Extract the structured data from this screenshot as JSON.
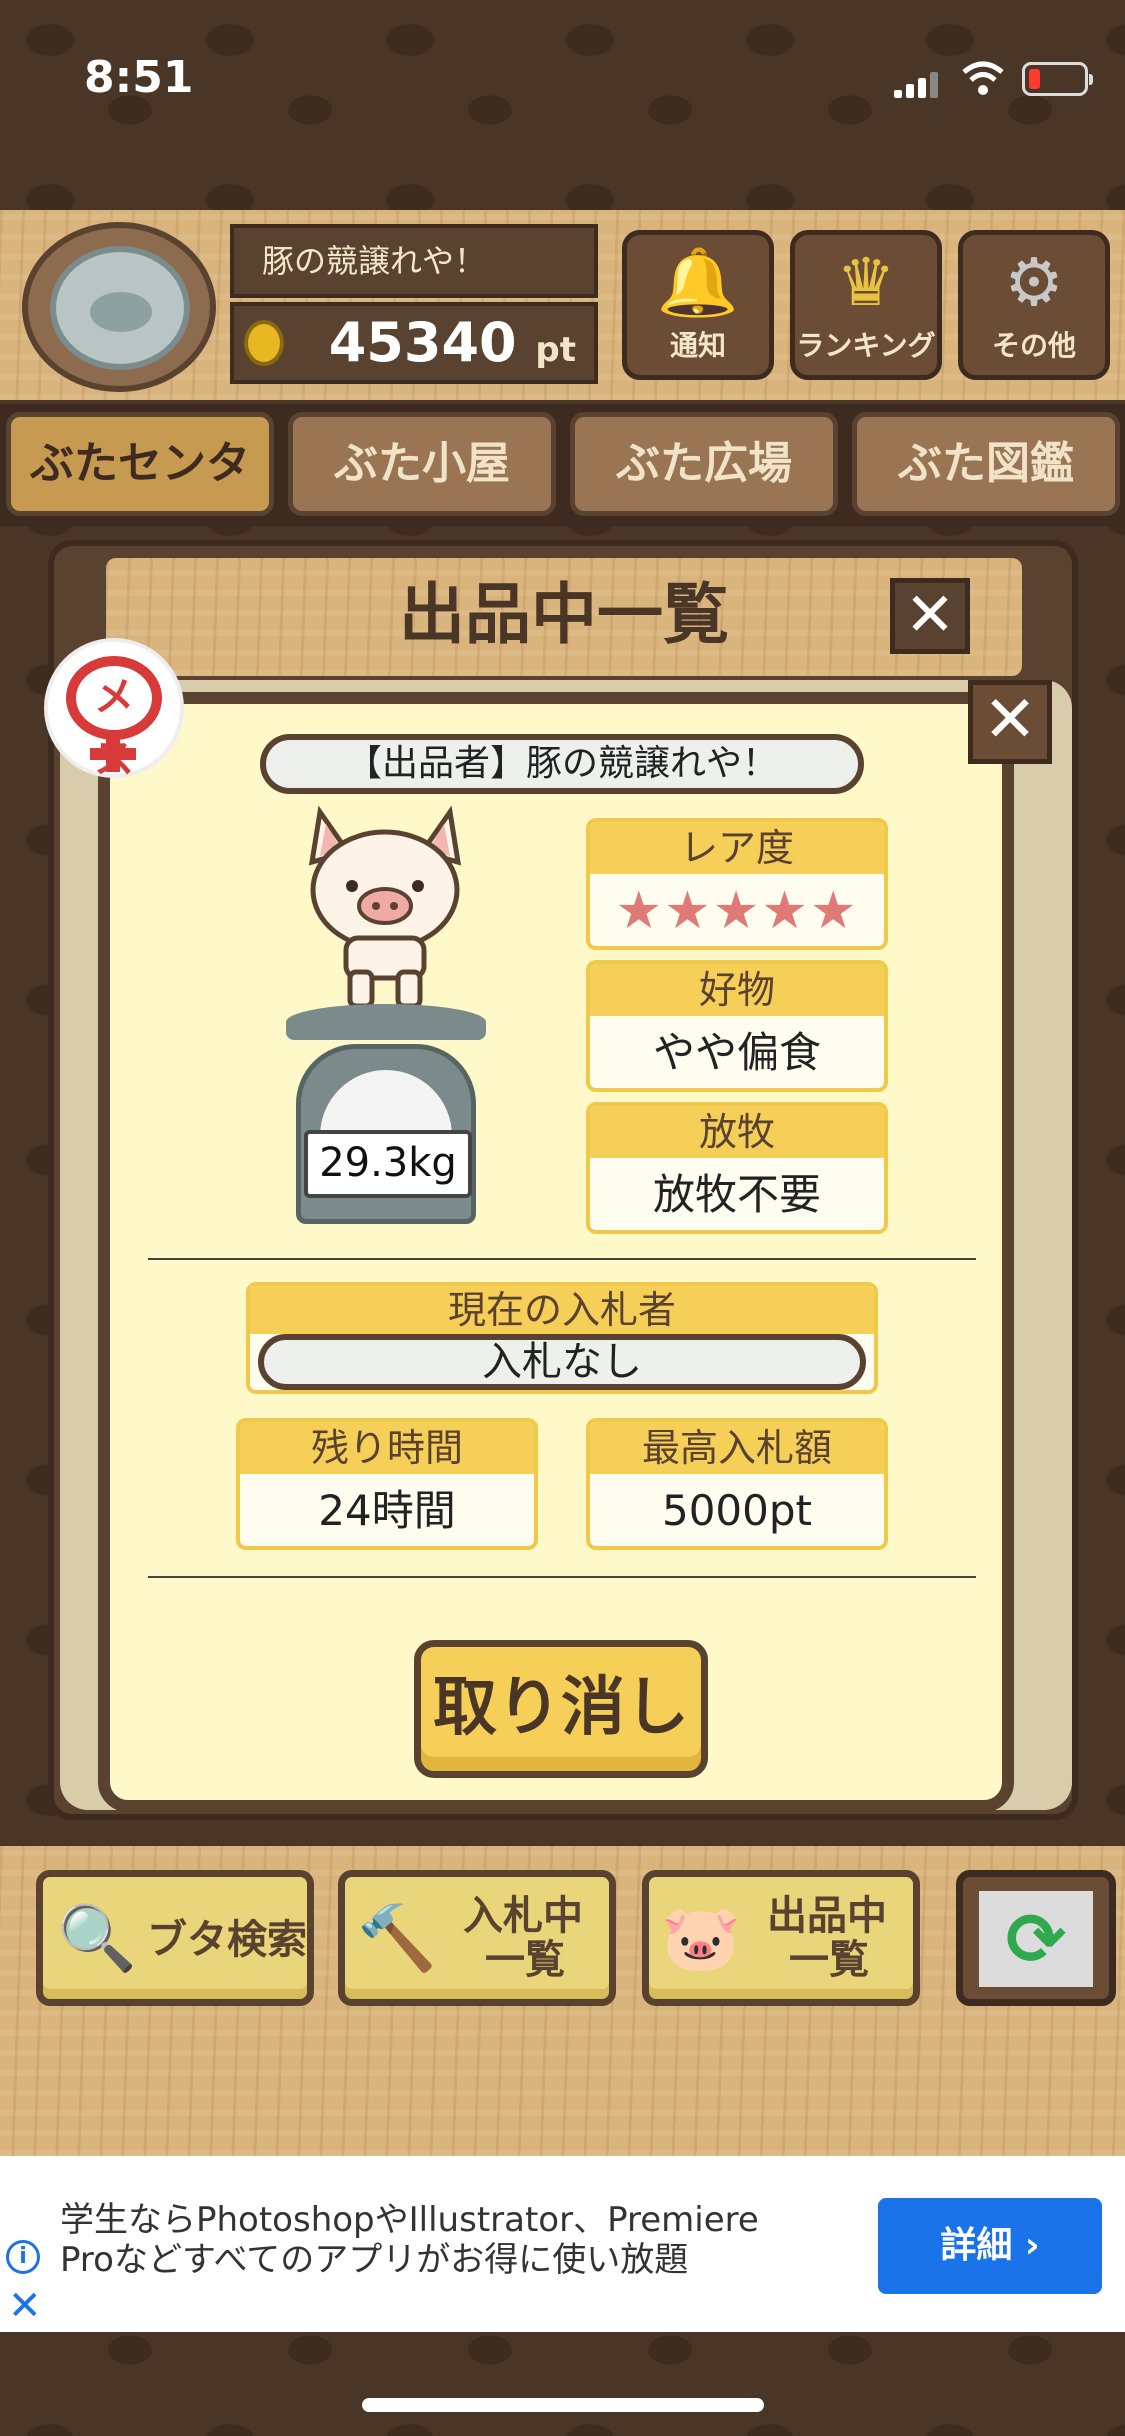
{
  "status": {
    "time": "8:51"
  },
  "player": {
    "name": "豚の競譲れや！",
    "points": "45340",
    "points_unit": "pt"
  },
  "top_buttons": [
    {
      "label": "通知",
      "icon": "bell-icon",
      "glyph": "🔔"
    },
    {
      "label": "ランキング",
      "icon": "crown-icon",
      "glyph": "♛"
    },
    {
      "label": "その他",
      "icon": "gear-icon",
      "glyph": "⚙"
    }
  ],
  "tabs": [
    "ぶたセンター",
    "ぶた小屋",
    "ぶた広場",
    "ぶた図鑑"
  ],
  "back_panel": {
    "title": "出品中一覧",
    "close": "✕"
  },
  "detail": {
    "close": "✕",
    "gender": "メス",
    "seller": "【出品者】豚の競譲れや！",
    "weight": "29.3kg",
    "rarity": {
      "label": "レア度",
      "stars": "★★★★★",
      "value": 5
    },
    "favorite": {
      "label": "好物",
      "value": "やや偏食"
    },
    "grazing": {
      "label": "放牧",
      "value": "放牧不要"
    },
    "bidder": {
      "label": "現在の入札者",
      "value": "入札なし"
    },
    "remaining": {
      "label": "残り時間",
      "value": "24時間"
    },
    "highest_bid": {
      "label": "最高入札額",
      "value": "5000pt"
    },
    "cancel": "取り消し"
  },
  "bottom_buttons": {
    "search": {
      "label": "ブタ検索",
      "glyph": "🔍"
    },
    "bidding": {
      "line1": "入札中",
      "line2": "一覧",
      "glyph": "🔨"
    },
    "listing": {
      "line1": "出品中",
      "line2": "一覧",
      "glyph": "🐷"
    },
    "refresh": {
      "glyph": "⟳"
    }
  },
  "ad": {
    "line1": "学生ならPhotoshopやIllustrator、Premiere",
    "line2": "Proなどすべてのアプリがお得に使い放題",
    "button": "詳細 ›",
    "info": "i",
    "close": "✕"
  }
}
